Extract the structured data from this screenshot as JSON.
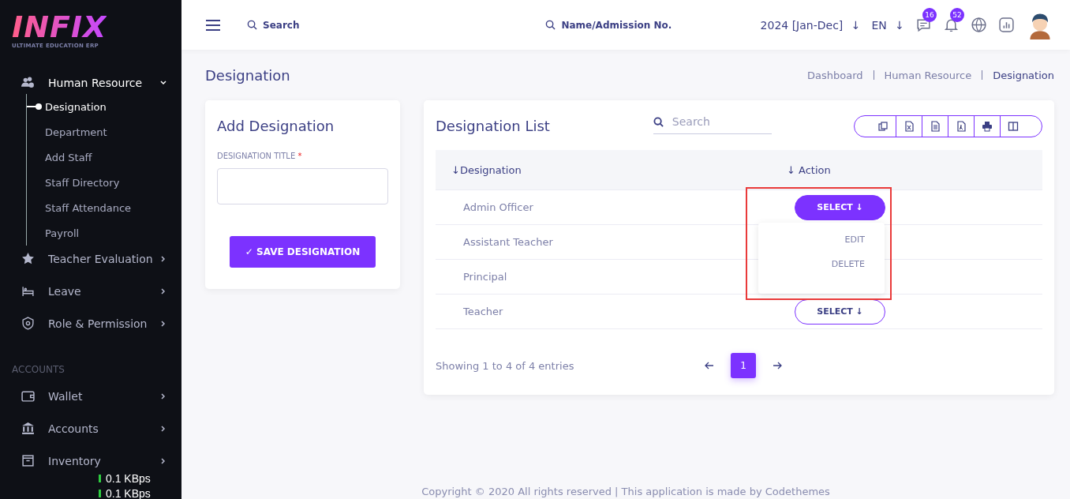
{
  "logo": {
    "name": "INFIX",
    "tagline": "ULTIMATE EDUCATION ERP"
  },
  "sidebar": {
    "items": [
      {
        "label": "Human Resource",
        "expanded": true,
        "children": [
          {
            "label": "Designation",
            "selected": true
          },
          {
            "label": "Department",
            "selected": false
          },
          {
            "label": "Add Staff",
            "selected": false
          },
          {
            "label": "Staff Directory",
            "selected": false
          },
          {
            "label": "Staff Attendance",
            "selected": false
          },
          {
            "label": "Payroll",
            "selected": false
          }
        ]
      },
      {
        "label": "Teacher Evaluation",
        "expanded": false
      },
      {
        "label": "Leave",
        "expanded": false
      },
      {
        "label": "Role & Permission",
        "expanded": false
      }
    ],
    "section": "ACCOUNTS",
    "section_items": [
      {
        "label": "Wallet",
        "expanded": false
      },
      {
        "label": "Accounts",
        "expanded": false
      },
      {
        "label": "Inventory",
        "expanded": false
      }
    ]
  },
  "net_speed": [
    "0.1 KBps",
    "0.1 KBps"
  ],
  "header": {
    "search": "Search",
    "student_search": "Name/Admission No.",
    "year": "2024 [Jan-Dec]",
    "year_arrow": "↓",
    "language": "EN",
    "language_arrow": "↓",
    "messages": "16",
    "notifications": "52"
  },
  "page": {
    "title": "Designation",
    "breadcrumb": [
      {
        "label": "Dashboard",
        "selected": false
      },
      {
        "label": "Human Resource",
        "selected": false
      },
      {
        "label": "Designation",
        "selected": true
      }
    ]
  },
  "form": {
    "title": "Add Designation",
    "field_label": "DESIGNATION TITLE",
    "required": "*",
    "button": "✓ SAVE DESIGNATION"
  },
  "list": {
    "title": "Designation List",
    "search_placeholder": "Search",
    "columns": [
      "↓Designation",
      "↓ Action"
    ],
    "rows": [
      {
        "designation": "Admin Officer",
        "button": "SELECT ↓",
        "open": true
      },
      {
        "designation": "Assistant Teacher"
      },
      {
        "designation": "Principal"
      },
      {
        "designation": "Teacher",
        "button": "SELECT ↓",
        "open": false
      }
    ],
    "menu": [
      "EDIT",
      "DELETE"
    ],
    "info": "Showing 1 to 4 of 4 entries",
    "pages": [
      {
        "label": "1",
        "selected": true
      }
    ]
  },
  "footer": "Copyright © 2020 All rights reserved | This application is made by Codethemes"
}
